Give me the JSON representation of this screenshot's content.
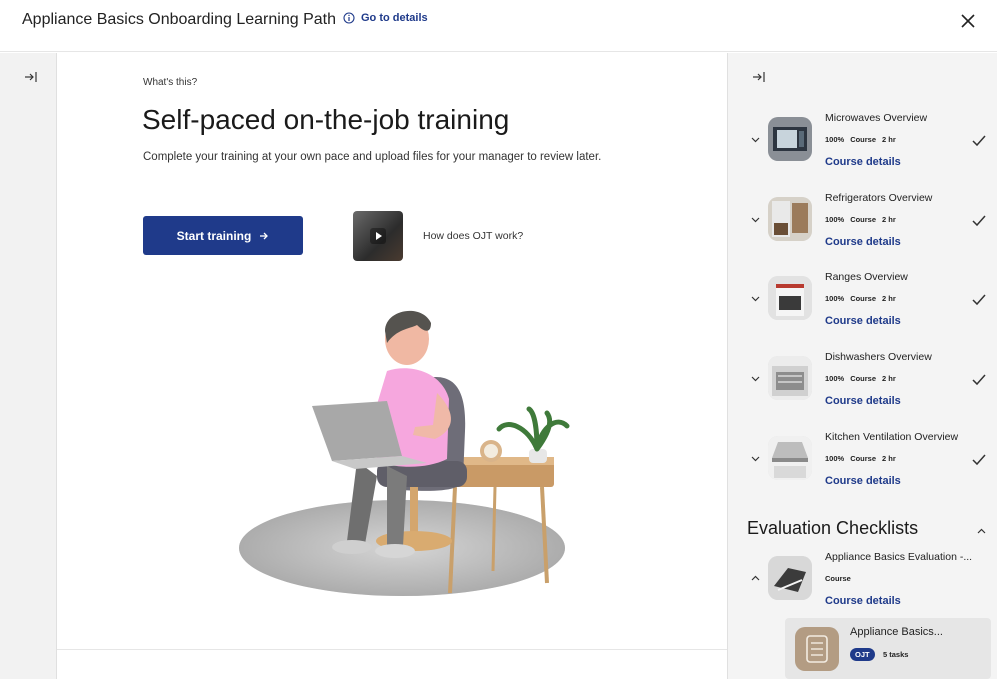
{
  "header": {
    "title": "Appliance Basics Onboarding Learning Path",
    "go_details": "Go to details"
  },
  "main": {
    "whats_this": "What's this?",
    "heading": "Self-paced on-the-job training",
    "subtitle": "Complete your training at your own pace and upload files for your manager to review later.",
    "start_button": "Start training",
    "how_ojt": "How does OJT work?"
  },
  "courses": [
    {
      "title": "Microwaves Overview",
      "progress": "100%",
      "type": "Course",
      "duration": "2 hr",
      "link": "Course details",
      "complete": true
    },
    {
      "title": "Refrigerators Overview",
      "progress": "100%",
      "type": "Course",
      "duration": "2 hr",
      "link": "Course details",
      "complete": true
    },
    {
      "title": "Ranges Overview",
      "progress": "100%",
      "type": "Course",
      "duration": "2 hr",
      "link": "Course details",
      "complete": true
    },
    {
      "title": "Dishwashers Overview",
      "progress": "100%",
      "type": "Course",
      "duration": "2 hr",
      "link": "Course details",
      "complete": true
    },
    {
      "title": "Kitchen Ventilation Overview",
      "progress": "100%",
      "type": "Course",
      "duration": "2 hr",
      "link": "Course details",
      "complete": true
    }
  ],
  "evaluation": {
    "heading": "Evaluation Checklists",
    "course": {
      "title": "Appliance Basics Evaluation -...",
      "type": "Course",
      "link": "Course details"
    },
    "ojt_item": {
      "title": "Appliance Basics...",
      "badge": "OJT",
      "tasks": "5 tasks"
    }
  },
  "colors": {
    "accent": "#1f3a8a",
    "sidebar_bg": "#f4f4f4",
    "rail_bg": "#f2f2f2"
  }
}
